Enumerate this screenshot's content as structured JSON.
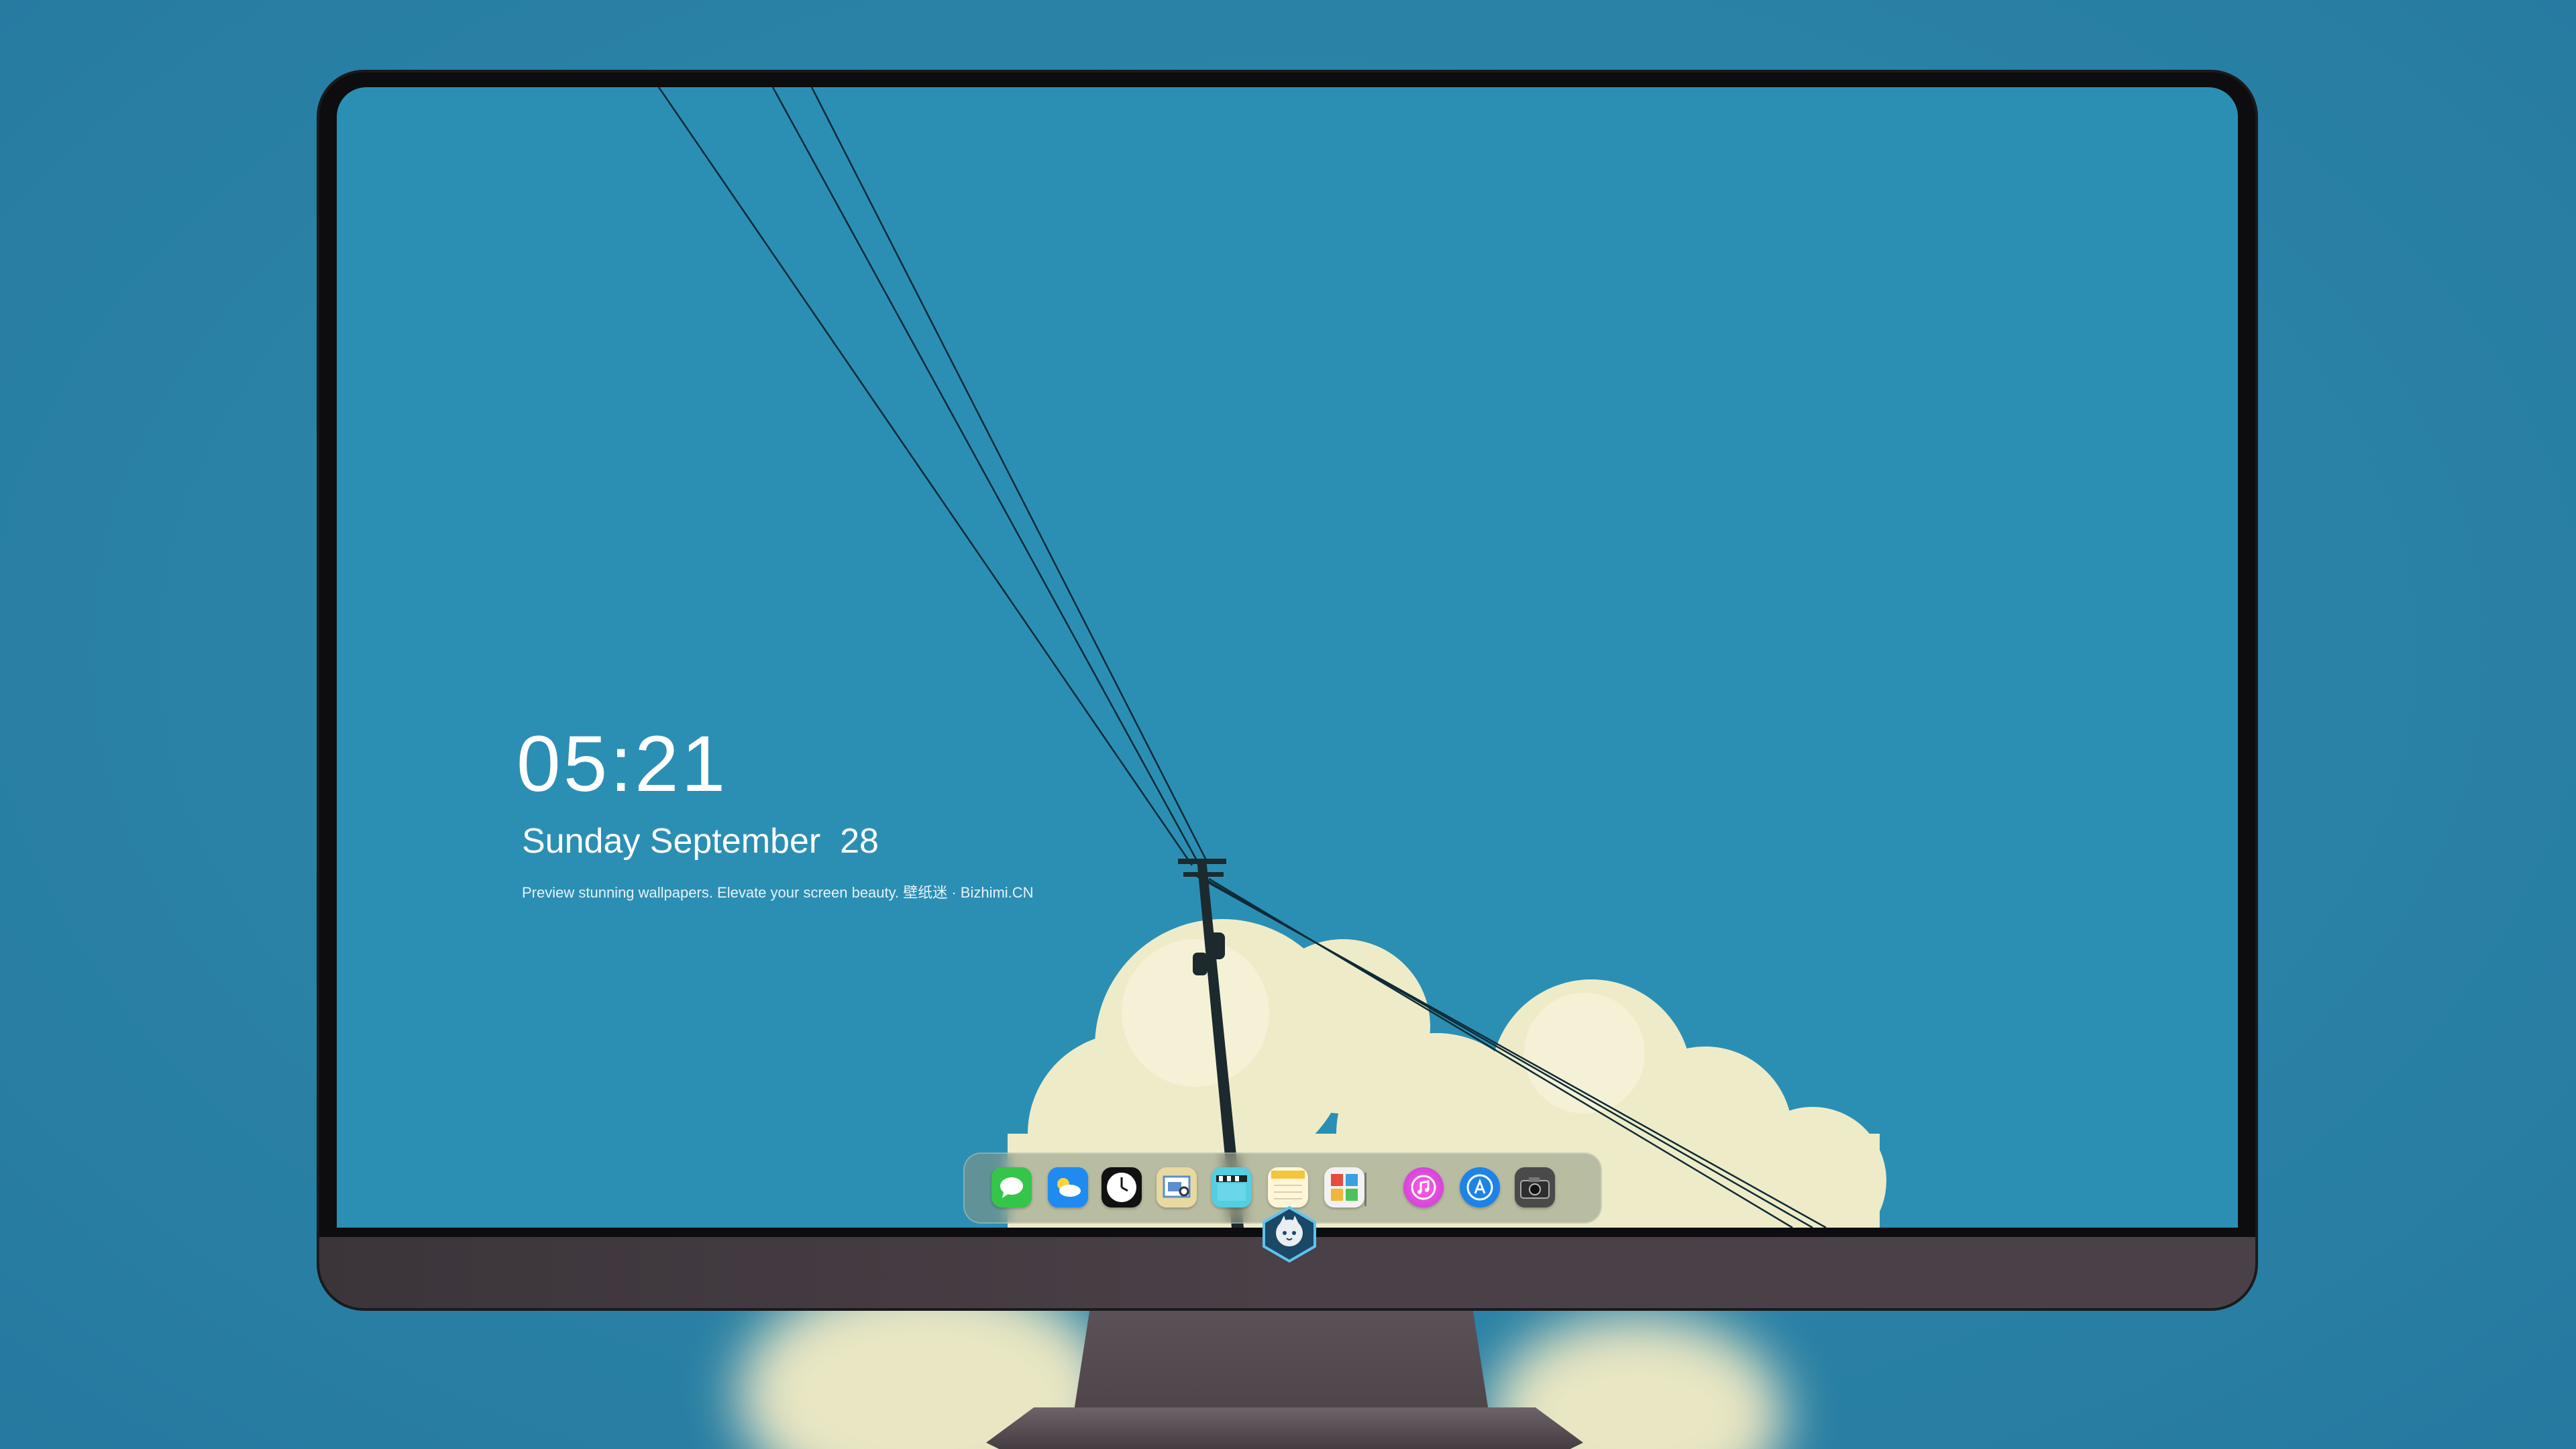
{
  "lockscreen": {
    "time": "05:21",
    "date": "Sunday September  28",
    "tagline": "Preview stunning wallpapers. Elevate your screen beauty. 壁纸迷 · Bizhimi.CN"
  },
  "dock": {
    "apps": [
      {
        "name": "messages-icon",
        "glyph": "💬"
      },
      {
        "name": "weather-icon",
        "glyph": "☁"
      },
      {
        "name": "clock-icon",
        "glyph": "🕐"
      },
      {
        "name": "preview-icon",
        "glyph": "🖼"
      },
      {
        "name": "video-clapper-icon",
        "glyph": "🎬"
      },
      {
        "name": "notes-icon",
        "glyph": "≡"
      },
      {
        "name": "photo-booth-icon",
        "glyph": "▦"
      },
      {
        "name": "itunes-icon",
        "glyph": "♫"
      },
      {
        "name": "app-store-icon",
        "glyph": "A"
      },
      {
        "name": "camera-icon",
        "glyph": "📷"
      }
    ]
  },
  "colors": {
    "background": "#2a81a3",
    "sky": "#2b8fb4",
    "cloud": "#eeecc8",
    "bezel": "#0d0d0f",
    "chin": "#463e44"
  }
}
